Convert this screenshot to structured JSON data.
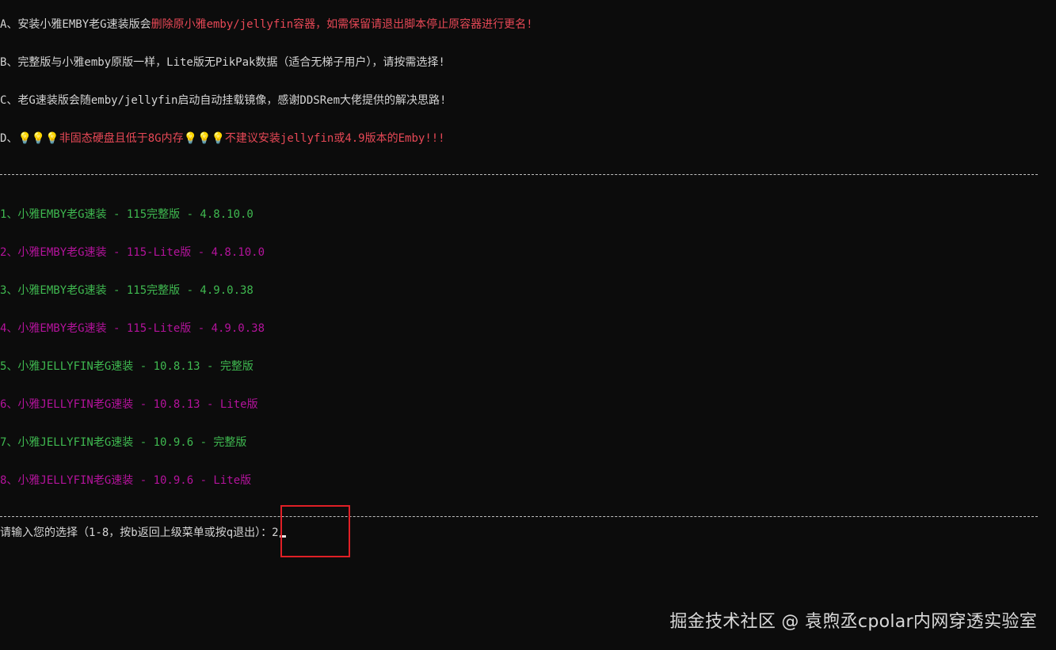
{
  "notes": {
    "a_prefix": "A、安装小雅EMBY老G速装版会",
    "a_warning": "删除原小雅emby/jellyfin容器，如需保留请退出脚本停止原容器进行更名!",
    "b": "B、完整版与小雅emby原版一样，Lite版无PikPak数据（适合无梯子用户），请按需选择!",
    "c": "C、老G速装版会随emby/jellyfin启动自动挂载镜像，感谢DDSRem大佬提供的解决思路!",
    "d_prefix": "D、",
    "d_text": "💡💡💡非固态硬盘且低于8G内存💡💡💡不建议安装jellyfin或4.9版本的Emby!!!"
  },
  "menu": [
    {
      "label": "1、小雅EMBY老G速装 - 115完整版 - 4.8.10.0",
      "color": "green"
    },
    {
      "label": "2、小雅EMBY老G速装 - 115-Lite版 - 4.8.10.0",
      "color": "magenta"
    },
    {
      "label": "3、小雅EMBY老G速装 - 115完整版 - 4.9.0.38",
      "color": "green"
    },
    {
      "label": "4、小雅EMBY老G速装 - 115-Lite版 - 4.9.0.38",
      "color": "magenta"
    },
    {
      "label": "5、小雅JELLYFIN老G速装 - 10.8.13 - 完整版",
      "color": "green"
    },
    {
      "label": "6、小雅JELLYFIN老G速装 - 10.8.13 - Lite版",
      "color": "magenta"
    },
    {
      "label": "7、小雅JELLYFIN老G速装 - 10.9.6 - 完整版",
      "color": "green"
    },
    {
      "label": "8、小雅JELLYFIN老G速装 - 10.9.6 - Lite版",
      "color": "magenta"
    }
  ],
  "prompt": {
    "text": "请输入您的选择（1-8，按b返回上级菜单或按q退出）：",
    "value": "2"
  },
  "watermark": "掘金技术社区 @ 袁煦丞cpolar内网穿透实验室",
  "colors": {
    "background": "#0c0c0c",
    "white_text": "#d4d4d4",
    "warning_red": "#e74856",
    "option_green": "#3fb950",
    "option_magenta": "#b4139c",
    "highlight_box": "#e01f26"
  }
}
